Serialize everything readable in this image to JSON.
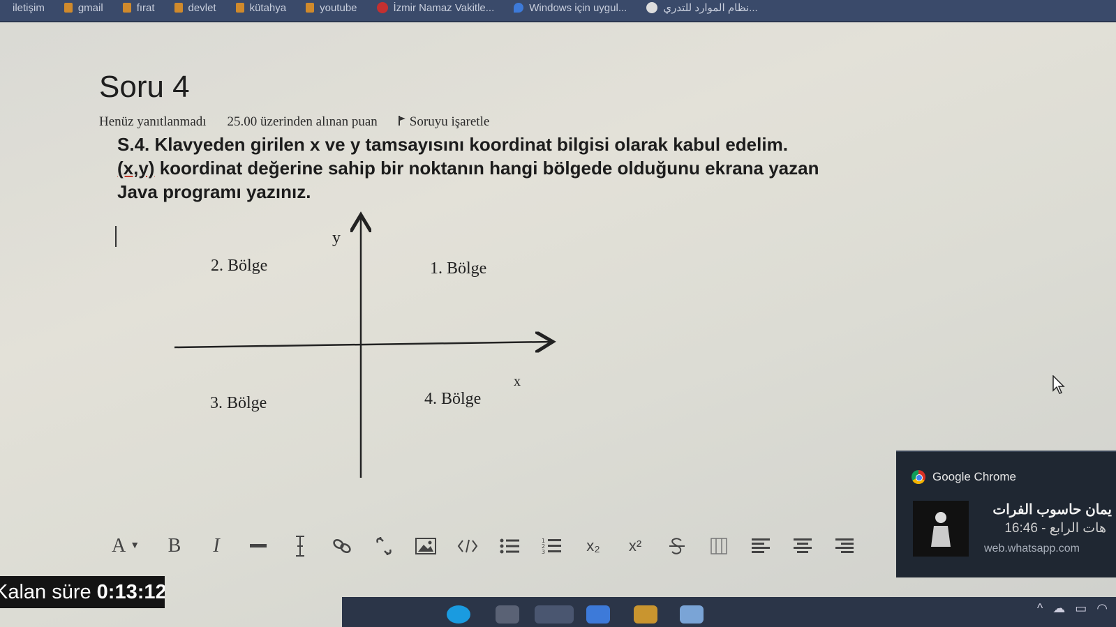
{
  "bookmarks": [
    {
      "label": "iletişim",
      "icon": "none"
    },
    {
      "label": "gmail",
      "icon": "folder-icon"
    },
    {
      "label": "fırat",
      "icon": "folder-icon"
    },
    {
      "label": "devlet",
      "icon": "folder-icon"
    },
    {
      "label": "kütahya",
      "icon": "folder-icon"
    },
    {
      "label": "youtube",
      "icon": "folder-icon"
    },
    {
      "label": "İzmir Namaz Vakitle...",
      "icon": "site-icon"
    },
    {
      "label": "Windows için uygul...",
      "icon": "windows-icon"
    },
    {
      "label": "نظام الموارد للتدري...",
      "icon": "site-icon"
    }
  ],
  "question": {
    "title": "Soru 4",
    "status": "Henüz yanıtlanmadı",
    "points": "25.00 üzerinden alınan puan",
    "flag_label": "Soruyu işaretle",
    "text_part1": "S.4. Klavyeden girilen x ve y tamsayısını koordinat bilgisi olarak kabul edelim. ",
    "text_xy": "(x,y)",
    "text_part2": " koordinat değerine sahip bir noktanın hangi bölgede olduğunu ekrana yazan Java programı yazınız."
  },
  "diagram": {
    "y_label": "y",
    "x_label": "x",
    "regions": [
      "1. Bölge",
      "2. Bölge",
      "3. Bölge",
      "4. Bölge"
    ]
  },
  "toolbar": {
    "font_color_label": "A",
    "bold_label": "B",
    "italic_label": "I",
    "subscript_label": "x₂",
    "superscript_label": "x²"
  },
  "timer": {
    "label": "Kalan süre",
    "value": "0:13:12"
  },
  "notification": {
    "app": "Google Chrome",
    "title": "يمان حاسوب الفرات",
    "subtitle": "16:46 - هات الرابع",
    "source": "web.whatsapp.com"
  }
}
